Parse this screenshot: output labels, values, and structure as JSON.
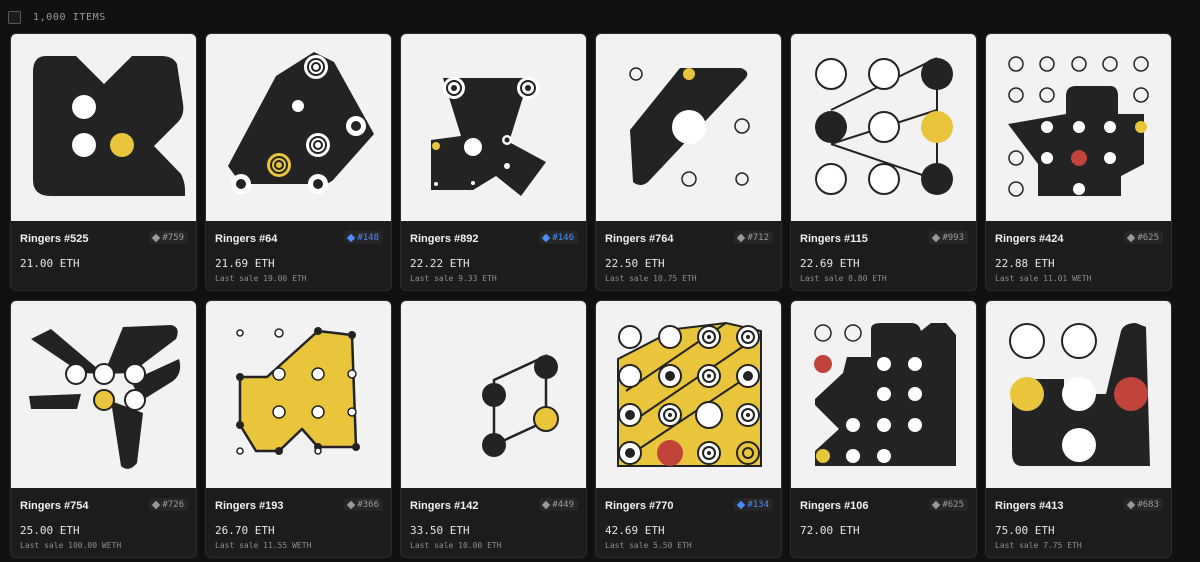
{
  "header": {
    "items_count": "1,000 ITEMS"
  },
  "colors": {
    "black": "#232323",
    "yellow": "#e8c53a",
    "red": "#c0443a",
    "art_bg": "#f2f2f2",
    "rank_blue": "#4c8dff"
  },
  "cards": [
    {
      "name": "Ringers #525",
      "rank": "#759",
      "rank_style": "gray",
      "price": "21.00 ETH",
      "last_sale": ""
    },
    {
      "name": "Ringers #64",
      "rank": "#148",
      "rank_style": "blue",
      "price": "21.69 ETH",
      "last_sale": "Last sale 19.00 ETH"
    },
    {
      "name": "Ringers #892",
      "rank": "#146",
      "rank_style": "blue",
      "price": "22.22 ETH",
      "last_sale": "Last sale 9.33 ETH"
    },
    {
      "name": "Ringers #764",
      "rank": "#712",
      "rank_style": "gray",
      "price": "22.50 ETH",
      "last_sale": "Last sale 10.75 ETH"
    },
    {
      "name": "Ringers #115",
      "rank": "#993",
      "rank_style": "gray",
      "price": "22.69 ETH",
      "last_sale": "Last sale 8.80 ETH"
    },
    {
      "name": "Ringers #424",
      "rank": "#625",
      "rank_style": "gray",
      "price": "22.88 ETH",
      "last_sale": "Last sale 11.01 WETH"
    },
    {
      "name": "Ringers #754",
      "rank": "#726",
      "rank_style": "gray",
      "price": "25.00 ETH",
      "last_sale": "Last sale 100.00 WETH"
    },
    {
      "name": "Ringers #193",
      "rank": "#366",
      "rank_style": "gray",
      "price": "26.70 ETH",
      "last_sale": "Last sale 11.55 WETH"
    },
    {
      "name": "Ringers #142",
      "rank": "#449",
      "rank_style": "gray",
      "price": "33.50 ETH",
      "last_sale": "Last sale 10.00 ETH"
    },
    {
      "name": "Ringers #770",
      "rank": "#134",
      "rank_style": "blue",
      "price": "42.69 ETH",
      "last_sale": "Last sale 5.50 ETH"
    },
    {
      "name": "Ringers #106",
      "rank": "#625",
      "rank_style": "gray",
      "price": "72.00 ETH",
      "last_sale": ""
    },
    {
      "name": "Ringers #413",
      "rank": "#683",
      "rank_style": "gray",
      "price": "75.00 ETH",
      "last_sale": "Last sale 7.75 ETH"
    }
  ]
}
